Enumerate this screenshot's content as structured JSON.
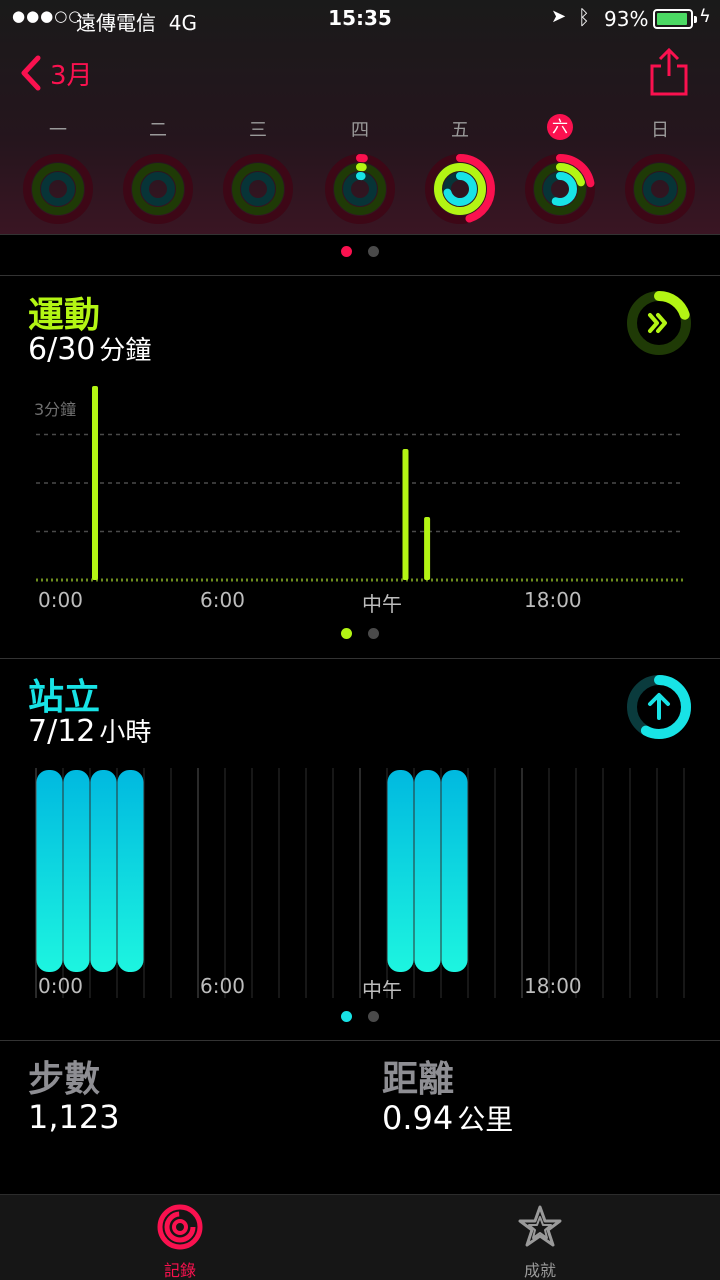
{
  "status_bar": {
    "signal": "●●●○○",
    "carrier": "遠傳電信",
    "network": "4G",
    "time": "15:35",
    "battery": "93%",
    "battery_level": 0.93
  },
  "header": {
    "back_label": "3月"
  },
  "week": {
    "days": [
      "一",
      "二",
      "三",
      "四",
      "五",
      "六",
      "日"
    ],
    "today_index": 5,
    "rings": [
      {
        "move": 0.0,
        "exercise": 0.0,
        "stand": 0.0
      },
      {
        "move": 0.0,
        "exercise": 0.0,
        "stand": 0.0
      },
      {
        "move": 0.0,
        "exercise": 0.0,
        "stand": 0.0
      },
      {
        "move": 0.02,
        "exercise": 0.02,
        "stand": 0.02
      },
      {
        "move": 0.45,
        "exercise": 1.0,
        "stand": 0.7
      },
      {
        "move": 0.22,
        "exercise": 0.2,
        "stand": 0.55
      },
      {
        "move": 0.0,
        "exercise": 0.0,
        "stand": 0.0
      }
    ]
  },
  "exercise": {
    "title": "運動",
    "value": "6/30",
    "unit": "分鐘",
    "progress": 0.2,
    "ref_label": "3分鐘"
  },
  "stand": {
    "title": "站立",
    "value": "7/12",
    "unit": "小時",
    "progress": 0.58
  },
  "steps": {
    "label": "步數",
    "value": "1,123"
  },
  "distance": {
    "label": "距離",
    "value": "0.94",
    "unit": "公里"
  },
  "chart_data": [
    {
      "type": "bar",
      "name": "exercise",
      "x_ticks": [
        "0:00",
        "6:00",
        "中午",
        "18:00"
      ],
      "x_range_hours": [
        0,
        24
      ],
      "ylim": [
        0,
        4
      ],
      "reference_line": 3,
      "reference_label": "3分鐘",
      "bars": [
        {
          "hour": 2,
          "value": 4.0
        },
        {
          "hour": 13.5,
          "value": 2.7
        },
        {
          "hour": 14.3,
          "value": 1.3
        }
      ]
    },
    {
      "type": "bar",
      "name": "stand",
      "x_ticks": [
        "0:00",
        "6:00",
        "中午",
        "18:00"
      ],
      "x_range_hours": [
        0,
        24
      ],
      "stood_hours": [
        0,
        1,
        2,
        3,
        13,
        14,
        15
      ]
    }
  ],
  "tabs": [
    {
      "label": "記錄",
      "active": true
    },
    {
      "label": "成就",
      "active": false
    }
  ],
  "colors": {
    "move": "#fa114f",
    "exercise": "#b3f514",
    "stand": "#18e3e6"
  }
}
